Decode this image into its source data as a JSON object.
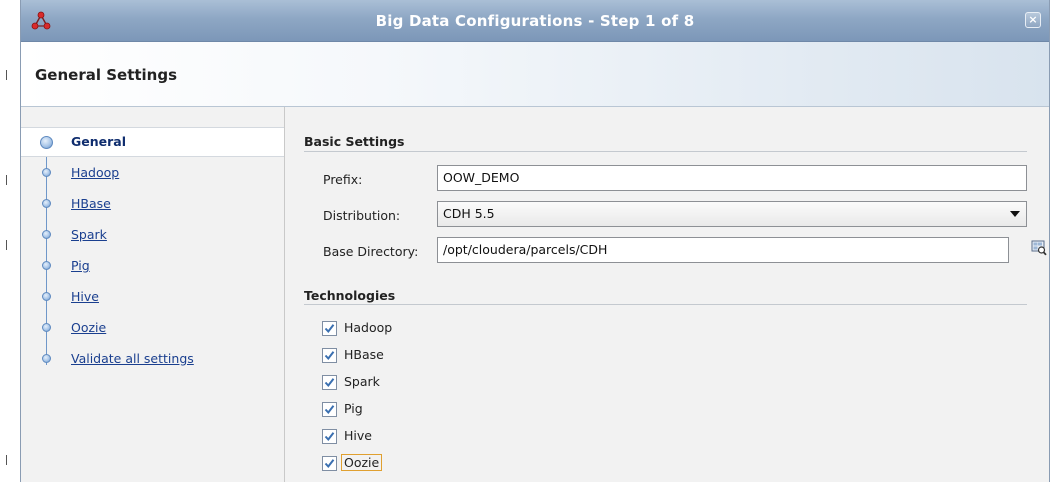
{
  "window": {
    "title": "Big Data Configurations - Step 1 of 8",
    "app_icon": "network-nodes-icon",
    "close_icon": "close-icon",
    "close_glyph": "×"
  },
  "header": {
    "title": "General Settings"
  },
  "sidebar": {
    "items": [
      {
        "label": "General",
        "active": true
      },
      {
        "label": "Hadoop",
        "active": false
      },
      {
        "label": "HBase",
        "active": false
      },
      {
        "label": "Spark",
        "active": false
      },
      {
        "label": "Pig",
        "active": false
      },
      {
        "label": "Hive",
        "active": false
      },
      {
        "label": "Oozie",
        "active": false
      },
      {
        "label": "Validate all settings",
        "active": false
      }
    ]
  },
  "basic_settings": {
    "section_title": "Basic Settings",
    "prefix": {
      "label": "Prefix:",
      "value": "OOW_DEMO"
    },
    "distribution": {
      "label": "Distribution:",
      "value": "CDH 5.5"
    },
    "base_directory": {
      "label": "Base Directory:",
      "value": "/opt/cloudera/parcels/CDH",
      "browse_icon": "browse-folder-icon"
    }
  },
  "technologies": {
    "section_title": "Technologies",
    "items": [
      {
        "label": "Hadoop",
        "checked": true
      },
      {
        "label": "HBase",
        "checked": true
      },
      {
        "label": "Spark",
        "checked": true
      },
      {
        "label": "Pig",
        "checked": true
      },
      {
        "label": "Hive",
        "checked": true
      },
      {
        "label": "Oozie",
        "checked": true
      }
    ]
  },
  "colors": {
    "titlebar": "#8ea7c4",
    "link": "#1a3f8f",
    "check": "#3a6fb0",
    "focus": "#e0a030"
  }
}
